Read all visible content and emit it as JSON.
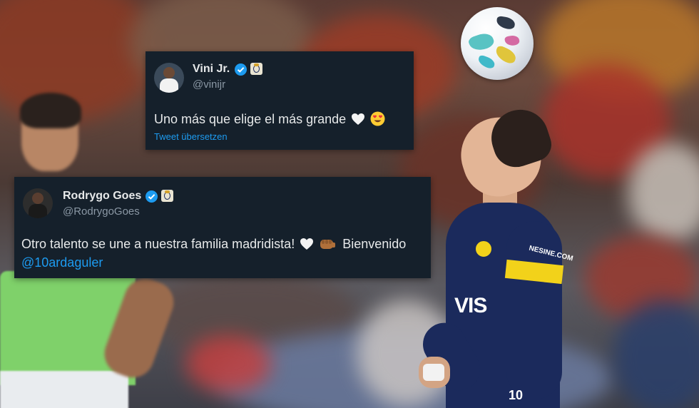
{
  "tweets": [
    {
      "name": "Vini Jr.",
      "handle": "@vinijr",
      "text": "Uno más que elige el más grande",
      "translate_link": "Tweet übersetzen",
      "emojis": [
        "white-heart",
        "heart-eyes"
      ]
    },
    {
      "name": "Rodrygo Goes",
      "handle": "@RodrygoGoes",
      "text_line1": "Otro talento se une a nuestra familia madridista!",
      "text_line1_suffix": "Bienvenido",
      "mention": "@10ardaguler",
      "emojis": [
        "white-heart",
        "fist-bump"
      ]
    }
  ],
  "player": {
    "shirt_sponsor": "NESINE.COM",
    "shirt_text": "VIS",
    "shirt_number": "10"
  },
  "colors": {
    "tweet_bg": "#15202b",
    "link": "#1d9bf0",
    "handle": "#8b98a5",
    "jersey": "#1b2a5c",
    "jersey_stripe": "#f2d21a",
    "bib": "#7fd16a"
  }
}
